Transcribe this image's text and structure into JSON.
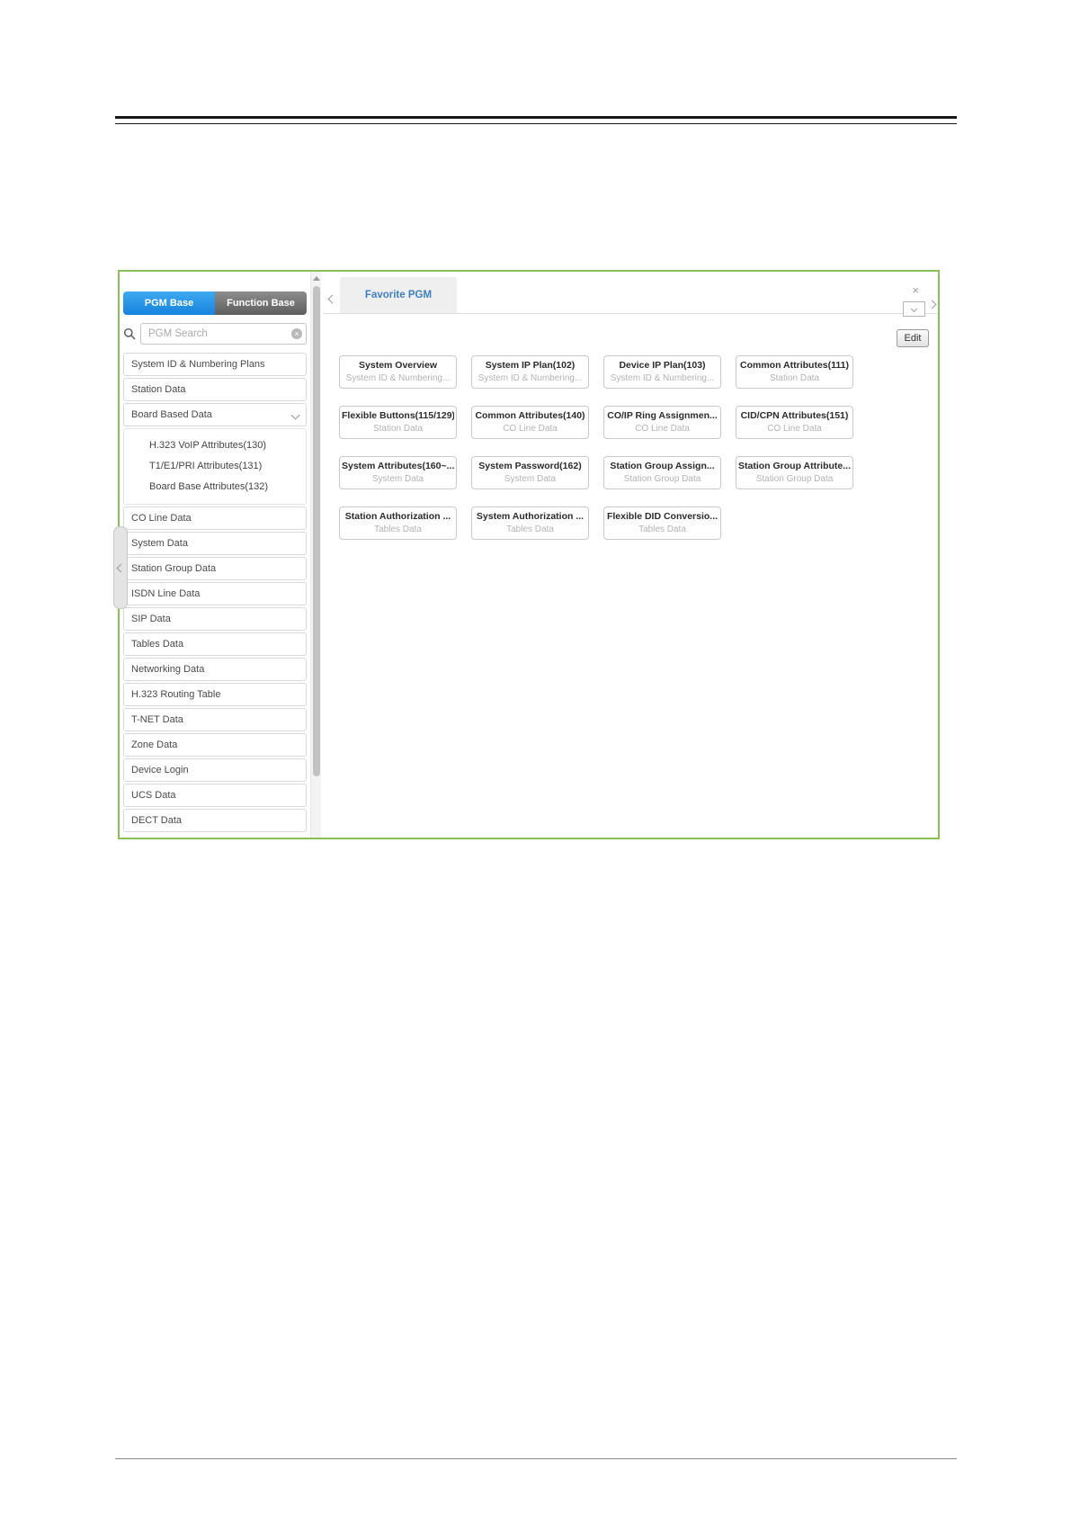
{
  "colors": {
    "container_border": "#8cbf5a",
    "active_tab_blue": "#1583dd",
    "inactive_tab_gray": "#5e5e5e",
    "favorite_tab_text": "#3f7fc1",
    "card_title": "#2b2b2b",
    "card_subtitle": "#b3b3b3"
  },
  "icons": {
    "search": "magnifier",
    "clear_search": "circle-x",
    "close_tab": "×",
    "clear_glyph": "×",
    "collapse_sidebar": "chevron-left",
    "expand_group": "chevron-down",
    "tab_prev": "chevron-left",
    "tab_next": "chevron-right",
    "tab_list_dropdown": "chevron-down",
    "scroll_up": "triangle-up"
  },
  "sidebar": {
    "tabs": [
      {
        "label": "PGM Base",
        "active": true
      },
      {
        "label": "Function Base",
        "active": false
      }
    ],
    "search_placeholder": "PGM Search",
    "items_top": [
      "System ID & Numbering Plans",
      "Station Data"
    ],
    "expandable_item": {
      "label": "Board Based Data",
      "state": "expanded",
      "children": [
        "H.323 VoIP Attributes(130)",
        "T1/E1/PRI Attributes(131)",
        "Board Base Attributes(132)"
      ]
    },
    "items_bottom": [
      "CO Line Data",
      "System Data",
      "Station Group Data",
      "ISDN Line Data",
      "SIP Data",
      "Tables Data",
      "Networking Data",
      "H.323 Routing Table",
      "T-NET Data",
      "Zone Data",
      "Device Login",
      "UCS Data",
      "DECT Data"
    ]
  },
  "main": {
    "tab_label": "Favorite PGM",
    "edit_label": "Edit",
    "cards": [
      {
        "title": "System Overview",
        "subtitle": "System ID & Numbering..."
      },
      {
        "title": "System IP Plan(102)",
        "subtitle": "System ID & Numbering..."
      },
      {
        "title": "Device IP Plan(103)",
        "subtitle": "System ID & Numbering..."
      },
      {
        "title": "Common Attributes(111)",
        "subtitle": "Station Data"
      },
      {
        "title": "Flexible Buttons(115/129)",
        "subtitle": "Station Data"
      },
      {
        "title": "Common Attributes(140)",
        "subtitle": "CO Line Data"
      },
      {
        "title": "CO/IP Ring Assignmen...",
        "subtitle": "CO Line Data"
      },
      {
        "title": "CID/CPN Attributes(151)",
        "subtitle": "CO Line Data"
      },
      {
        "title": "System Attributes(160~...",
        "subtitle": "System Data"
      },
      {
        "title": "System Password(162)",
        "subtitle": "System Data"
      },
      {
        "title": "Station Group Assign...",
        "subtitle": "Station Group Data"
      },
      {
        "title": "Station Group Attribute...",
        "subtitle": "Station Group Data"
      },
      {
        "title": "Station Authorization ...",
        "subtitle": "Tables Data"
      },
      {
        "title": "System Authorization ...",
        "subtitle": "Tables Data"
      },
      {
        "title": "Flexible DID Conversio...",
        "subtitle": "Tables Data"
      }
    ]
  }
}
